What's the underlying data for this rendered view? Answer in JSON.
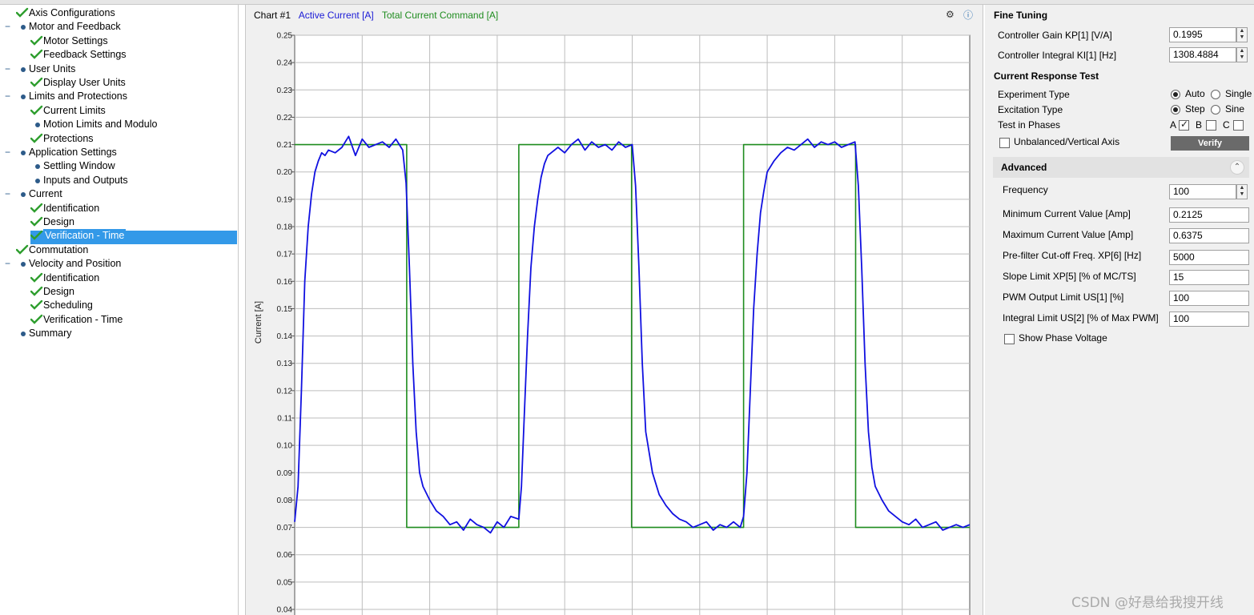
{
  "tree": {
    "items": [
      {
        "label": "Axis Configurations",
        "status": "check",
        "level": 0
      },
      {
        "label": "Motor and Feedback",
        "status": "dot",
        "level": 0,
        "collapsible": true
      },
      {
        "label": "Motor Settings",
        "status": "check",
        "level": 1
      },
      {
        "label": "Feedback Settings",
        "status": "check",
        "level": 1
      },
      {
        "label": "User Units",
        "status": "dot",
        "level": 0,
        "collapsible": true
      },
      {
        "label": "Display User Units",
        "status": "check",
        "level": 1
      },
      {
        "label": "Limits and Protections",
        "status": "dot",
        "level": 0,
        "collapsible": true
      },
      {
        "label": "Current Limits",
        "status": "check",
        "level": 1
      },
      {
        "label": "Motion Limits and Modulo",
        "status": "dot",
        "level": 1
      },
      {
        "label": "Protections",
        "status": "check",
        "level": 1
      },
      {
        "label": "Application Settings",
        "status": "dot",
        "level": 0,
        "collapsible": true
      },
      {
        "label": "Settling Window",
        "status": "dot",
        "level": 1
      },
      {
        "label": "Inputs and Outputs",
        "status": "dot",
        "level": 1
      },
      {
        "label": "Current",
        "status": "dot",
        "level": 0,
        "collapsible": true
      },
      {
        "label": "Identification",
        "status": "check",
        "level": 1
      },
      {
        "label": "Design",
        "status": "check",
        "level": 1
      },
      {
        "label": "Verification - Time",
        "status": "check",
        "level": 1,
        "selected": true
      },
      {
        "label": "Commutation",
        "status": "check",
        "level": 0
      },
      {
        "label": "Velocity and Position",
        "status": "dot",
        "level": 0,
        "collapsible": true
      },
      {
        "label": "Identification",
        "status": "check",
        "level": 1
      },
      {
        "label": "Design",
        "status": "check",
        "level": 1
      },
      {
        "label": "Scheduling",
        "status": "check",
        "level": 1
      },
      {
        "label": "Verification - Time",
        "status": "check",
        "level": 1
      },
      {
        "label": "Summary",
        "status": "dot",
        "level": 0
      }
    ]
  },
  "chart_header": {
    "title": "Chart #1",
    "legend_active": "Active Current [A]",
    "legend_command": "Total Current Command [A]"
  },
  "chart_data": {
    "type": "line",
    "ylabel": "Current [A]",
    "ylim": [
      0.04,
      0.25
    ],
    "yticks": [
      "0.25",
      "0.24",
      "0.23",
      "0.22",
      "0.21",
      "0.20",
      "0.19",
      "0.18",
      "0.17",
      "0.16",
      "0.15",
      "0.14",
      "0.13",
      "0.12",
      "0.11",
      "0.10",
      "0.09",
      "0.08",
      "0.07",
      "0.06",
      "0.05",
      "0.04"
    ],
    "grid": true,
    "xlim": [
      0,
      1
    ],
    "series": [
      {
        "name": "Total Current Command [A]",
        "color": "#1e8c1e",
        "x": [
          0.0,
          0.166,
          0.166,
          0.332,
          0.332,
          0.499,
          0.499,
          0.665,
          0.665,
          0.831,
          0.831,
          1.0
        ],
        "y": [
          0.21,
          0.21,
          0.07,
          0.07,
          0.21,
          0.21,
          0.07,
          0.07,
          0.21,
          0.21,
          0.07,
          0.07
        ]
      },
      {
        "name": "Active Current [A]",
        "color": "#1010e0",
        "x": [
          0.0,
          0.005,
          0.01,
          0.015,
          0.02,
          0.025,
          0.03,
          0.035,
          0.04,
          0.045,
          0.05,
          0.06,
          0.07,
          0.08,
          0.09,
          0.1,
          0.11,
          0.12,
          0.13,
          0.14,
          0.15,
          0.16,
          0.165,
          0.17,
          0.175,
          0.18,
          0.185,
          0.19,
          0.2,
          0.21,
          0.22,
          0.23,
          0.24,
          0.25,
          0.26,
          0.27,
          0.28,
          0.29,
          0.3,
          0.31,
          0.32,
          0.332,
          0.336,
          0.34,
          0.345,
          0.35,
          0.355,
          0.36,
          0.365,
          0.37,
          0.375,
          0.38,
          0.39,
          0.4,
          0.41,
          0.42,
          0.43,
          0.44,
          0.45,
          0.46,
          0.47,
          0.48,
          0.49,
          0.5,
          0.505,
          0.51,
          0.515,
          0.52,
          0.53,
          0.54,
          0.55,
          0.56,
          0.57,
          0.58,
          0.59,
          0.6,
          0.61,
          0.62,
          0.63,
          0.64,
          0.65,
          0.66,
          0.665,
          0.67,
          0.675,
          0.68,
          0.685,
          0.69,
          0.695,
          0.7,
          0.71,
          0.72,
          0.73,
          0.74,
          0.75,
          0.76,
          0.77,
          0.78,
          0.79,
          0.8,
          0.81,
          0.82,
          0.83,
          0.835,
          0.84,
          0.845,
          0.85,
          0.855,
          0.86,
          0.87,
          0.88,
          0.89,
          0.9,
          0.91,
          0.92,
          0.93,
          0.94,
          0.95,
          0.96,
          0.97,
          0.98,
          0.99,
          1.0
        ],
        "y": [
          0.072,
          0.085,
          0.12,
          0.16,
          0.18,
          0.192,
          0.2,
          0.204,
          0.207,
          0.206,
          0.208,
          0.207,
          0.209,
          0.213,
          0.206,
          0.212,
          0.209,
          0.21,
          0.211,
          0.209,
          0.212,
          0.208,
          0.196,
          0.165,
          0.13,
          0.105,
          0.09,
          0.085,
          0.08,
          0.076,
          0.074,
          0.071,
          0.072,
          0.069,
          0.073,
          0.071,
          0.07,
          0.068,
          0.072,
          0.07,
          0.074,
          0.073,
          0.085,
          0.11,
          0.14,
          0.165,
          0.18,
          0.19,
          0.198,
          0.203,
          0.206,
          0.207,
          0.209,
          0.207,
          0.21,
          0.212,
          0.208,
          0.211,
          0.209,
          0.21,
          0.208,
          0.211,
          0.209,
          0.21,
          0.195,
          0.165,
          0.13,
          0.105,
          0.09,
          0.082,
          0.078,
          0.075,
          0.073,
          0.072,
          0.07,
          0.071,
          0.072,
          0.069,
          0.071,
          0.07,
          0.072,
          0.07,
          0.074,
          0.09,
          0.12,
          0.15,
          0.17,
          0.185,
          0.193,
          0.2,
          0.204,
          0.207,
          0.209,
          0.208,
          0.21,
          0.212,
          0.209,
          0.211,
          0.21,
          0.211,
          0.209,
          0.21,
          0.211,
          0.195,
          0.165,
          0.13,
          0.105,
          0.092,
          0.085,
          0.08,
          0.076,
          0.074,
          0.072,
          0.071,
          0.073,
          0.07,
          0.071,
          0.072,
          0.069,
          0.07,
          0.071,
          0.07,
          0.071
        ]
      }
    ]
  },
  "fine_tuning": {
    "title": "Fine Tuning",
    "kp_label": "Controller Gain KP[1] [V/A]",
    "kp_value": "0.1995",
    "ki_label": "Controller Integral KI[1] [Hz]",
    "ki_value": "1308.4884"
  },
  "response_test": {
    "title": "Current Response Test",
    "experiment_label": "Experiment Type",
    "experiment_auto": "Auto",
    "experiment_single": "Single",
    "excitation_label": "Excitation Type",
    "excitation_step": "Step",
    "excitation_sine": "Sine",
    "phases_label": "Test in Phases",
    "phase_a": "A",
    "phase_b": "B",
    "phase_c": "C",
    "unbalanced_label": "Unbalanced/Vertical Axis",
    "verify_label": "Verify"
  },
  "advanced": {
    "title": "Advanced",
    "frequency_label": "Frequency",
    "frequency_value": "100",
    "min_current_label": "Minimum Current Value [Amp]",
    "min_current_value": "0.2125",
    "max_current_label": "Maximum Current Value [Amp]",
    "max_current_value": "0.6375",
    "prefilter_label": "Pre-filter Cut-off Freq. XP[6] [Hz]",
    "prefilter_value": "5000",
    "slope_label": "Slope Limit XP[5] [% of MC/TS]",
    "slope_value": "15",
    "pwm_label": "PWM Output Limit US[1] [%]",
    "pwm_value": "100",
    "integral_label": "Integral Limit US[2] [% of Max PWM]",
    "integral_value": "100",
    "show_phase_label": "Show Phase Voltage"
  },
  "watermark": "CSDN @好悬给我搜开线"
}
